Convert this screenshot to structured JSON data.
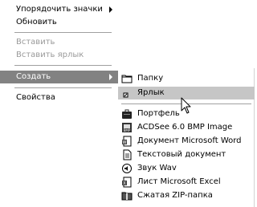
{
  "context_menu": {
    "items": [
      {
        "label": "Упорядочить значки",
        "mnemonic_first": "У",
        "rest": "порядочить значки"
      },
      {
        "label": "Обновить"
      },
      {
        "label": "Вставить"
      },
      {
        "label": "Вставить ярлык"
      },
      {
        "label": "Создать"
      },
      {
        "label": "Свойства"
      }
    ]
  },
  "submenu": {
    "items": [
      {
        "label": "Папку",
        "icon": "folder-icon"
      },
      {
        "label": "Ярлык",
        "icon": "shortcut-icon"
      },
      {
        "label": "Портфель",
        "icon": "briefcase-icon"
      },
      {
        "label": "ACDSee 6.0 BMP Image",
        "icon": "bmp-image-icon"
      },
      {
        "label": "Документ Microsoft Word",
        "icon": "word-document-icon"
      },
      {
        "label": "Текстовый документ",
        "icon": "text-document-icon"
      },
      {
        "label": "Звук Wav",
        "icon": "wav-sound-icon"
      },
      {
        "label": "Лист Microsoft Excel",
        "icon": "excel-sheet-icon"
      },
      {
        "label": "Сжатая ZIP-папка",
        "icon": "zip-folder-icon"
      }
    ]
  },
  "colors": {
    "highlight_main": "#828282",
    "highlight_sub": "#c6c6c6",
    "disabled_text": "#9a9a9a"
  }
}
